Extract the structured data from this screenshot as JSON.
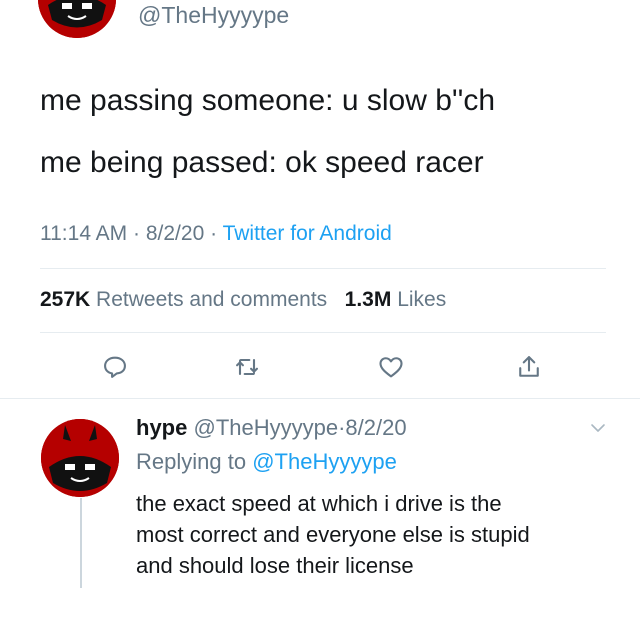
{
  "tweet": {
    "handle": "@TheHyyyype",
    "line1": "me passing someone: u slow b''ch",
    "line2": "me being passed: ok speed racer",
    "time": "11:14 AM",
    "sep1": "·",
    "date": "8/2/20",
    "sep2": "·",
    "client": "Twitter for Android",
    "retweets_count": "257K",
    "retweets_label": "Retweets and comments",
    "likes_count": "1.3M",
    "likes_label": "Likes"
  },
  "actions": [
    {
      "icon": "reply-icon"
    },
    {
      "icon": "retweet-icon"
    },
    {
      "icon": "like-icon"
    },
    {
      "icon": "share-icon"
    }
  ],
  "reply": {
    "name": "hype",
    "handle": "@TheHyyyype",
    "sep": "·",
    "date": "8/2/20",
    "replying_label": "Replying to",
    "replying_to": "@TheHyyyype",
    "text_line1": "the exact speed at which i drive is the",
    "text_line2": "most correct and everyone else is stupid",
    "text_line3": "and should lose their license"
  },
  "colors": {
    "link": "#1da1f2",
    "muted": "#657786",
    "avatar_red": "#b50000"
  }
}
